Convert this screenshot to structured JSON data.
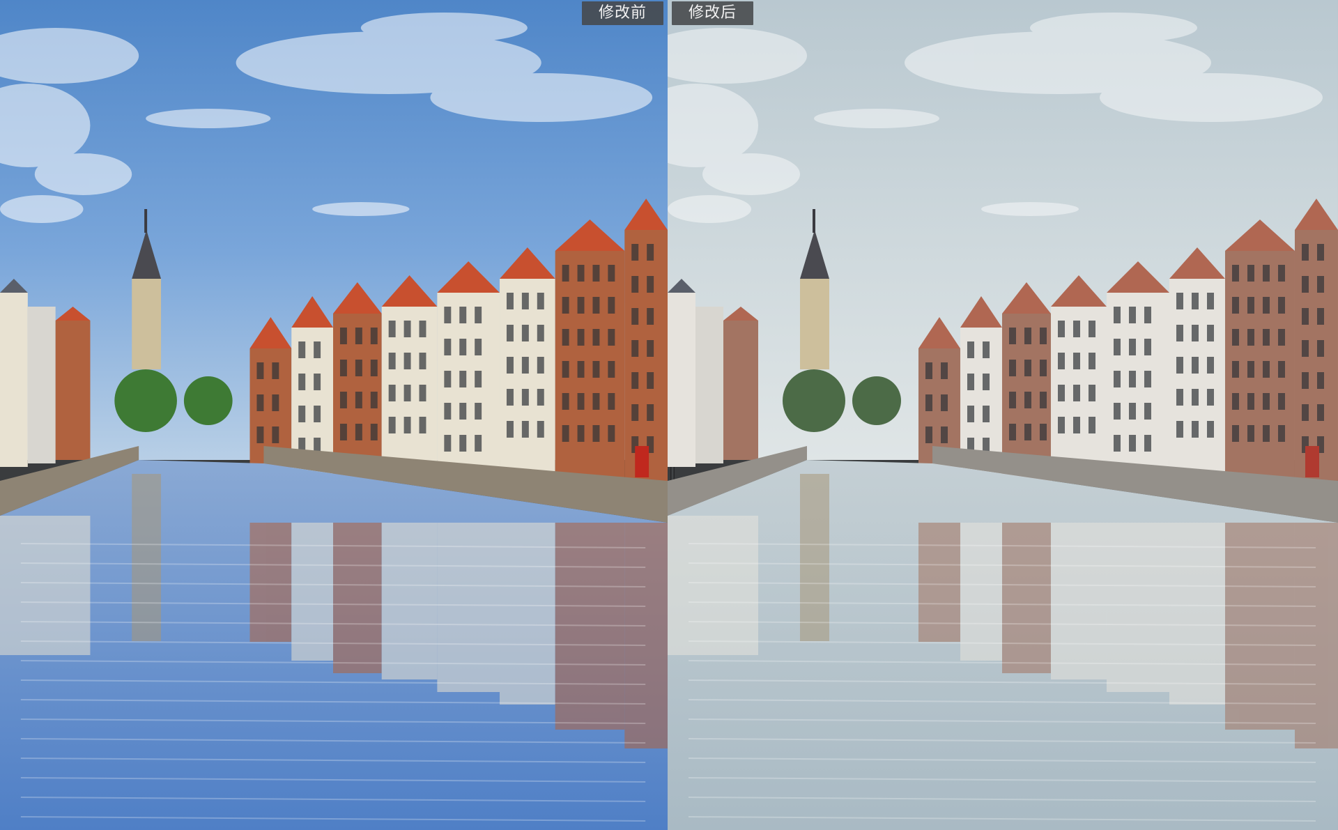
{
  "comparison": {
    "before": {
      "label": "修改前",
      "palette": {
        "sky_top": "#4f86c8",
        "sky_mid": "#7aa6da",
        "sky_low": "#b8cfe6",
        "water_top": "#8aa9d4",
        "water_bottom": "#4f7fc6",
        "brick": "#b0623f",
        "roof": "#c8502f",
        "plaster": "#e8e2d2",
        "stone": "#8e8474",
        "tree": "#3e7a34",
        "shutter_red": "#c0281e"
      }
    },
    "after": {
      "label": "修改后",
      "palette": {
        "sky_top": "#b9c8d0",
        "sky_mid": "#cfd9dd",
        "sky_low": "#dfe5e6",
        "water_top": "#c4cfd4",
        "water_bottom": "#a9bac4",
        "brick": "#a37462",
        "roof": "#b06752",
        "plaster": "#e6e3dd",
        "stone": "#94908a",
        "tree": "#4c6b47",
        "shutter_red": "#b03a30"
      }
    }
  },
  "icons": {
    "divider": "split-handle-icon"
  }
}
